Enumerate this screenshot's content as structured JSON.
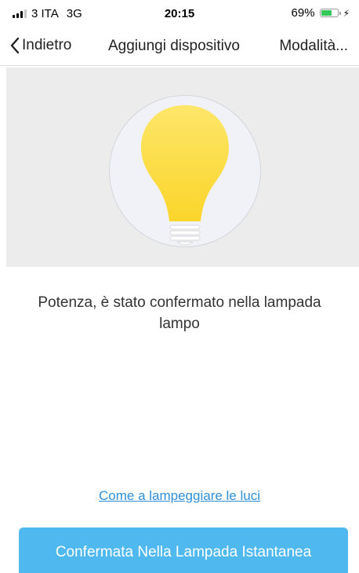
{
  "status_bar": {
    "carrier": "3 ITA",
    "network": "3G",
    "time": "20:15",
    "battery_percent": "69%",
    "battery_level": 0.69,
    "signal_bars": 3,
    "signal_total": 4,
    "charging_icon": "bolt-icon"
  },
  "nav": {
    "back_label": "Indietro",
    "title": "Aggiungi dispositivo",
    "mode_label": "Modalità..."
  },
  "hero": {
    "icon": "light-bulb-icon"
  },
  "message": {
    "text": "Potenza, è stato confermato nella lampada lampo"
  },
  "help": {
    "link_text": "Come a lampeggiare le luci"
  },
  "confirm": {
    "label": "Confermata Nella Lampada Istantanea"
  },
  "colors": {
    "accent": "#4fb8ee",
    "link": "#2f8fd8",
    "bulb": "#fde35a",
    "battery": "#34c759"
  }
}
